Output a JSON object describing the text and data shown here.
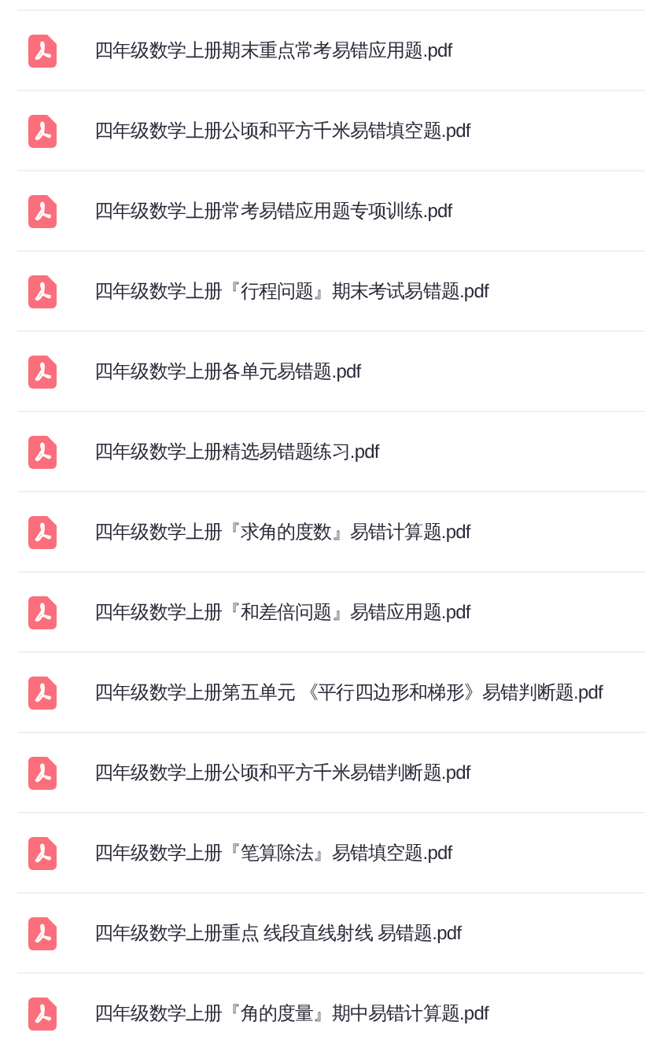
{
  "files": [
    {
      "name": "四年级数学上册期末重点常考易错应用题.pdf"
    },
    {
      "name": "四年级数学上册公顷和平方千米易错填空题.pdf"
    },
    {
      "name": "四年级数学上册常考易错应用题专项训练.pdf"
    },
    {
      "name": "四年级数学上册『行程问题』期末考试易错题.pdf"
    },
    {
      "name": "四年级数学上册各单元易错题.pdf"
    },
    {
      "name": "四年级数学上册精选易错题练习.pdf"
    },
    {
      "name": "四年级数学上册『求角的度数』易错计算题.pdf"
    },
    {
      "name": "四年级数学上册『和差倍问题』易错应用题.pdf"
    },
    {
      "name": "四年级数学上册第五单元 《平行四边形和梯形》易错判断题.pdf"
    },
    {
      "name": "四年级数学上册公顷和平方千米易错判断题.pdf"
    },
    {
      "name": "四年级数学上册『笔算除法』易错填空题.pdf"
    },
    {
      "name": "四年级数学上册重点 线段直线射线 易错题.pdf"
    },
    {
      "name": "四年级数学上册『角的度量』期中易错计算题.pdf"
    }
  ]
}
